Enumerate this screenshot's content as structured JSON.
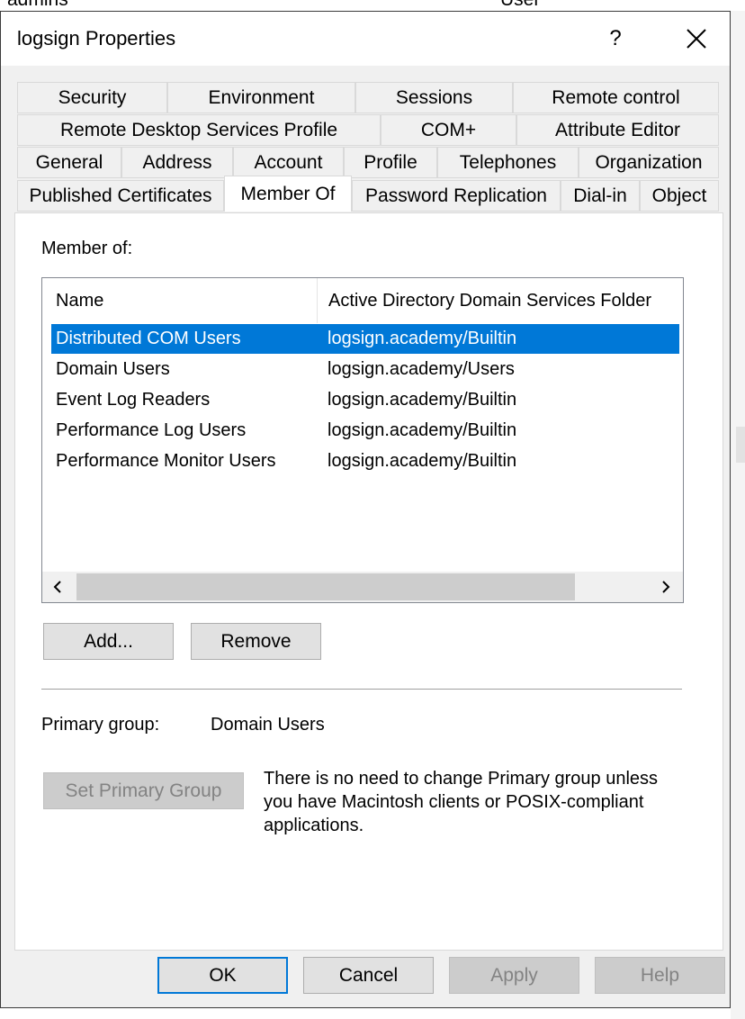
{
  "background": {
    "left_fragment": "admins",
    "right_fragment": "User"
  },
  "dialog": {
    "title": "logsign Properties",
    "help_label": "?",
    "close_icon": "close-icon"
  },
  "tabs": {
    "row1": [
      "Security",
      "Environment",
      "Sessions",
      "Remote control"
    ],
    "row2": [
      "Remote Desktop Services Profile",
      "COM+",
      "Attribute Editor"
    ],
    "row3": [
      "General",
      "Address",
      "Account",
      "Profile",
      "Telephones",
      "Organization"
    ],
    "row4": [
      "Published Certificates",
      "Member Of",
      "Password Replication",
      "Dial-in",
      "Object"
    ],
    "active": "Member Of"
  },
  "member_of": {
    "label": "Member of:",
    "columns": [
      "Name",
      "Active Directory Domain Services Folder"
    ],
    "rows": [
      {
        "name": "Distributed COM Users",
        "folder": "logsign.academy/Builtin",
        "selected": true
      },
      {
        "name": "Domain Users",
        "folder": "logsign.academy/Users",
        "selected": false
      },
      {
        "name": "Event Log Readers",
        "folder": "logsign.academy/Builtin",
        "selected": false
      },
      {
        "name": "Performance Log Users",
        "folder": "logsign.academy/Builtin",
        "selected": false
      },
      {
        "name": "Performance Monitor Users",
        "folder": "logsign.academy/Builtin",
        "selected": false
      }
    ],
    "scroll_left_icon": "chevron-left-icon",
    "scroll_right_icon": "chevron-right-icon"
  },
  "buttons": {
    "add": "Add...",
    "remove": "Remove",
    "set_primary_group": "Set Primary Group",
    "ok": "OK",
    "cancel": "Cancel",
    "apply": "Apply",
    "help": "Help"
  },
  "primary_group": {
    "label": "Primary group:",
    "value": "Domain Users",
    "note": "There is no need to change Primary group unless you have Macintosh clients or POSIX-compliant applications."
  },
  "colors": {
    "selection": "#0078d7",
    "dialog_bg": "#f0f0f0",
    "panel_bg": "#ffffff"
  }
}
